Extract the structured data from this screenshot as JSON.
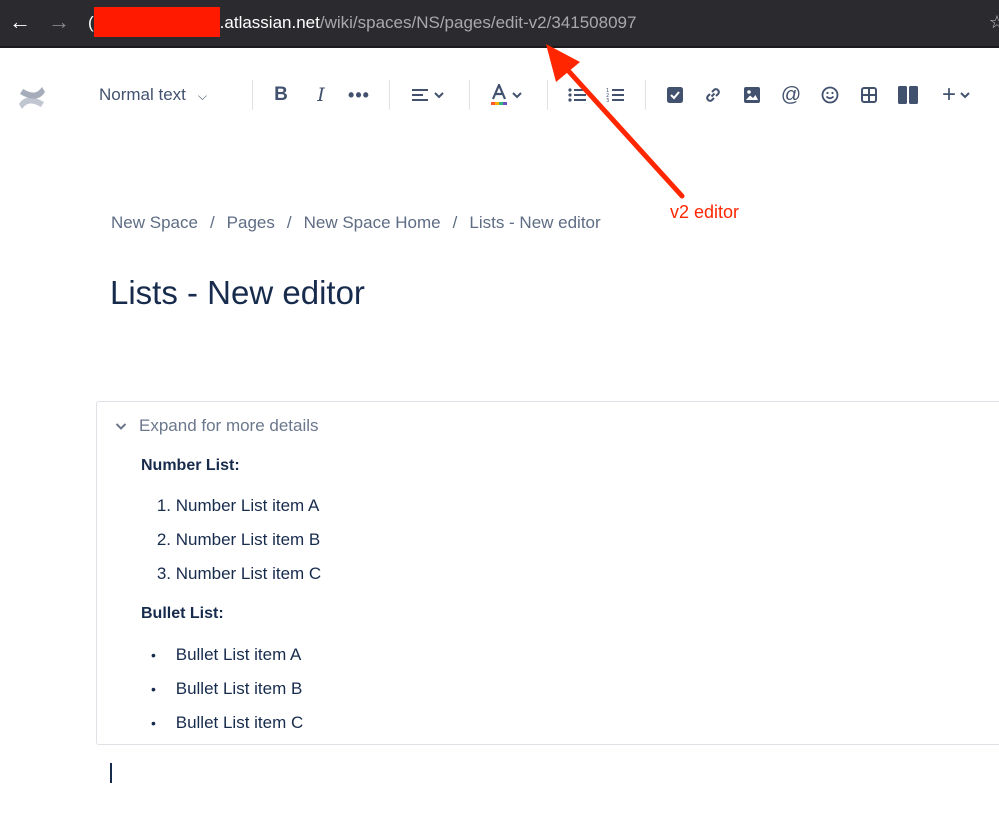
{
  "browser": {
    "back_icon": "←",
    "forward_icon": "→",
    "url_lead": "(",
    "url_domain": ".atlassian.net",
    "url_path": "/wiki/spaces/NS/pages/edit-v2/341508097"
  },
  "toolbar": {
    "text_style": "Normal text",
    "bold": "B",
    "italic": "I",
    "more": "•••",
    "mention": "@",
    "insert": "+"
  },
  "annotation": {
    "label": "v2 editor",
    "color": "#ff2600"
  },
  "breadcrumb": {
    "items": [
      "New Space",
      "Pages",
      "New Space Home",
      "Lists - New editor"
    ],
    "separator": "/"
  },
  "page": {
    "title": "Lists - New editor"
  },
  "expand": {
    "title": "Expand for more details",
    "number_heading": "Number List:",
    "number_items": [
      {
        "marker": "1.",
        "text": "Number List item A"
      },
      {
        "marker": "2.",
        "text": "Number List item B"
      },
      {
        "marker": "3.",
        "text": "Number List item C"
      }
    ],
    "bullet_heading": "Bullet List:",
    "bullet_items": [
      {
        "marker": "•",
        "text": "Bullet List item A"
      },
      {
        "marker": "•",
        "text": "Bullet List item B"
      },
      {
        "marker": "•",
        "text": "Bullet List item C"
      }
    ]
  },
  "colors": {
    "browser_bar": "#2b2a2e",
    "text_primary": "#172b4d",
    "text_subtle": "#5e6c84",
    "icon": "#42526e",
    "redaction": "#ff1a00"
  }
}
